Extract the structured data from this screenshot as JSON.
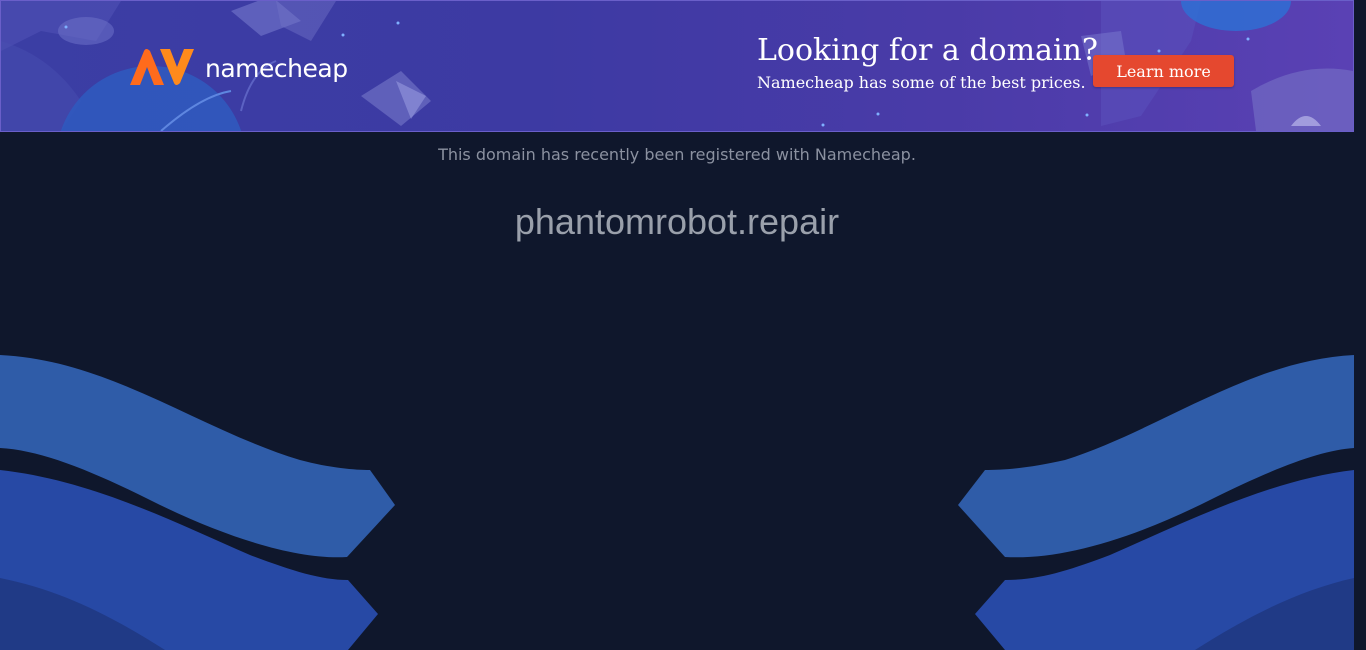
{
  "banner": {
    "brand": "namecheap",
    "promo_title": "Looking for a domain?",
    "promo_subtitle": "Namecheap has some of the best prices.",
    "cta_label": "Learn more",
    "colors": {
      "background": "#3d3aa3",
      "logo_orange": "#ff6a1a",
      "cta": "#e5482f"
    }
  },
  "main": {
    "registered_note": "This domain has recently been registered with Namecheap.",
    "domain": "phantomrobot.repair"
  },
  "theme": {
    "page_background": "#0f172c",
    "wave_light": "#2f5ca8",
    "wave_mid": "#2749a5",
    "wave_dark": "#203a86"
  }
}
